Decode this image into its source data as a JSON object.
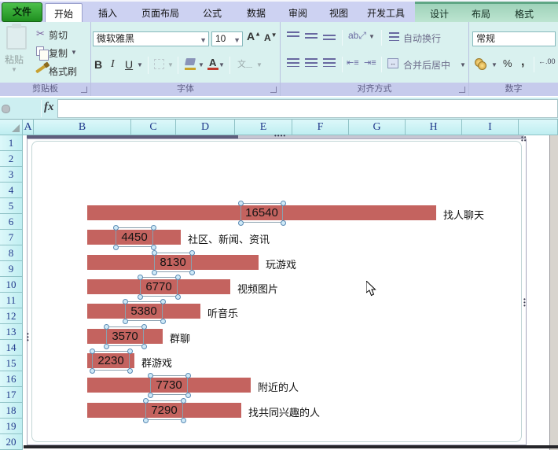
{
  "tabs": {
    "file": "文件",
    "items": [
      {
        "label": "开始",
        "active": true
      },
      {
        "label": "插入",
        "active": false
      },
      {
        "label": "页面布局",
        "active": false
      },
      {
        "label": "公式",
        "active": false
      },
      {
        "label": "数据",
        "active": false
      },
      {
        "label": "审阅",
        "active": false
      },
      {
        "label": "视图",
        "active": false
      },
      {
        "label": "开发工具",
        "active": false
      }
    ],
    "contextual": [
      "设计",
      "布局",
      "格式"
    ]
  },
  "ribbon": {
    "clipboard": {
      "title": "剪贴板",
      "paste": "粘贴",
      "cut": "剪切",
      "copy": "复制",
      "format_painter": "格式刷"
    },
    "font": {
      "title": "字体",
      "font_name": "微软雅黑",
      "font_size": "10",
      "bold": "B",
      "italic": "I",
      "underline": "U",
      "phonetic": "文"
    },
    "alignment": {
      "title": "对齐方式",
      "wrap_text": "自动换行",
      "merge_center": "合并后居中"
    },
    "number": {
      "title": "数字",
      "format": "常规",
      "percent": "%",
      "comma": ",",
      "decimal": ".00"
    }
  },
  "formula_bar": {
    "fx": "fx",
    "value": ""
  },
  "sheet": {
    "columns": [
      "A",
      "B",
      "C",
      "D",
      "E",
      "F",
      "G",
      "H",
      "I"
    ],
    "rows": [
      "1",
      "2",
      "3",
      "4",
      "5",
      "6",
      "7",
      "8",
      "9",
      "10",
      "11",
      "12",
      "13",
      "14",
      "15",
      "16",
      "17",
      "18",
      "19",
      "20"
    ]
  },
  "chart_data": {
    "type": "bar",
    "orientation": "horizontal",
    "categories": [
      "找人聊天",
      "社区、新闻、资讯",
      "玩游戏",
      "视频图片",
      "听音乐",
      "群聊",
      "群游戏",
      "附近的人",
      "找共同兴趣的人"
    ],
    "values": [
      16540,
      4450,
      8130,
      6770,
      5380,
      3570,
      2230,
      7730,
      7290
    ],
    "xlim": [
      0,
      16540
    ],
    "bar_color": "#c4635f",
    "value_labels_position": "center",
    "category_labels_position": "outside-end",
    "grid": false,
    "legend": false,
    "title": "",
    "selection": "data-labels-selected"
  },
  "colors": {
    "bar": "#c4635f",
    "tabbar_bg": "#cdd2f2",
    "ribbon_bg": "#d9f1ef",
    "group_label_bg": "#c6cbec",
    "header_bg": "#c6f1f4",
    "file_button": "#2aa22a",
    "contextual_bg": "#a9d8c2"
  }
}
